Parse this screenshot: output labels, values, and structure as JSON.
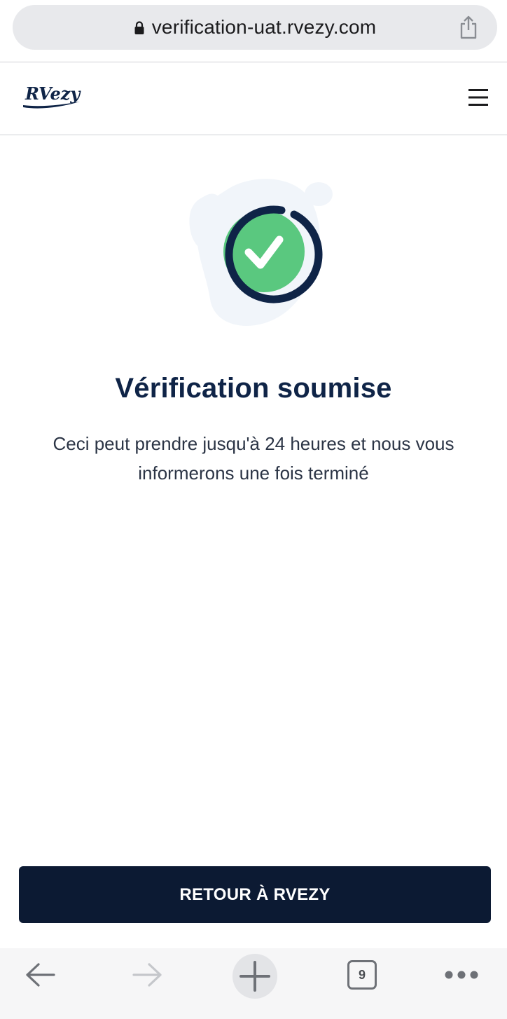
{
  "browser": {
    "url": "verification-uat.rvezy.com",
    "tab_count": "9",
    "icons": {
      "lock": "lock-icon",
      "share": "share-icon",
      "back": "arrow-left-icon",
      "forward": "arrow-right-icon",
      "new_tab": "plus-icon",
      "tabs": "tabs-icon",
      "more": "ellipsis-icon"
    }
  },
  "header": {
    "logo_text": "RVezy",
    "menu_icon": "hamburger-menu-icon"
  },
  "main": {
    "status_icon": "check-circle-icon",
    "title": "Vérification soumise",
    "description": "Ceci peut prendre jusqu'à 24 heures et nous vous informerons une fois terminé",
    "button_label": "RETOUR À RVEZY"
  },
  "colors": {
    "brand_navy": "#0f2447",
    "button_bg": "#0c1a33",
    "success_green": "#5ac87f",
    "blob_bg": "#f1f5fa"
  }
}
